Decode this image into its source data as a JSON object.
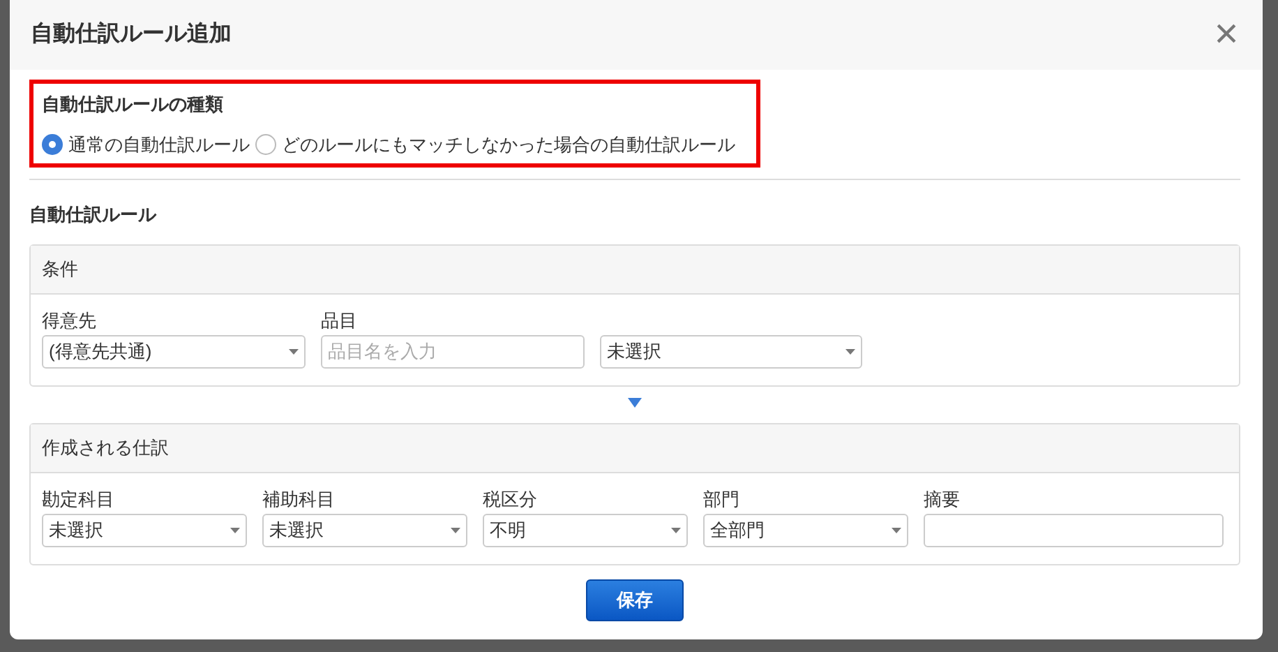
{
  "dialog": {
    "title": "自動仕訳ルール追加",
    "close_label": "×"
  },
  "rule_type": {
    "label": "自動仕訳ルールの種類",
    "options": [
      {
        "label": "通常の自動仕訳ルール",
        "selected": true
      },
      {
        "label": "どのルールにもマッチしなかった場合の自動仕訳ルール",
        "selected": false
      }
    ]
  },
  "rule_section": {
    "title": "自動仕訳ルール"
  },
  "conditions": {
    "title": "条件",
    "fields": [
      {
        "kind": "select",
        "label": "得意先",
        "value": "(得意先共通)"
      },
      {
        "kind": "input",
        "label": "品目",
        "placeholder": "品目名を入力"
      },
      {
        "kind": "select",
        "value": "未選択"
      }
    ]
  },
  "journal": {
    "title": "作成される仕訳",
    "fields": [
      {
        "kind": "select",
        "label": "勘定科目",
        "value": "未選択"
      },
      {
        "kind": "select",
        "label": "補助科目",
        "value": "未選択"
      },
      {
        "kind": "select",
        "label": "税区分",
        "value": "不明"
      },
      {
        "kind": "select",
        "label": "部門",
        "value": "全部門"
      },
      {
        "kind": "input",
        "label": "摘要"
      }
    ]
  },
  "save_button": "保存"
}
